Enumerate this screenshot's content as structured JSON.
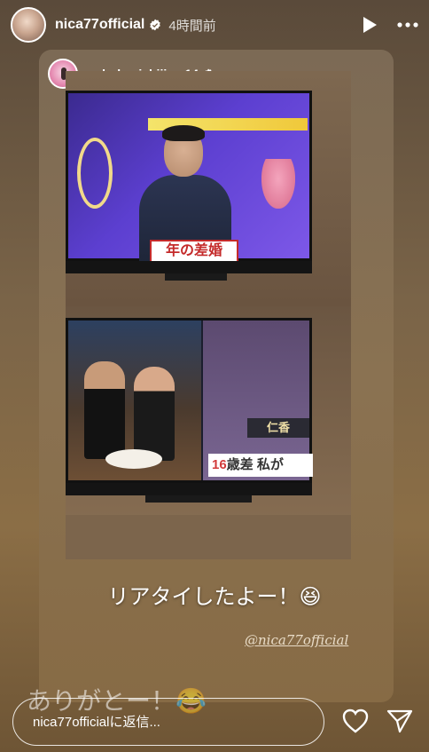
{
  "header": {
    "username": "nica77official",
    "time": "4時間前"
  },
  "shared_post": {
    "username": "nobuko_ishijima14",
    "tv_screen_top": {
      "caption": "年の差婚"
    },
    "tv_screen_bottom": {
      "name_tag": "仁香",
      "caption_num": "16",
      "caption_text": "歳差 私が"
    }
  },
  "story_text": {
    "caption": "リアタイしたよー！😆",
    "mention": "@nica77official",
    "overlay": "ありがとー！😂"
  },
  "footer": {
    "reply_placeholder": "nica77officialに返信..."
  },
  "colors": {
    "background_top": "#5a4a3a",
    "background_bottom": "#8b6e46",
    "verified": "#ffffff"
  }
}
